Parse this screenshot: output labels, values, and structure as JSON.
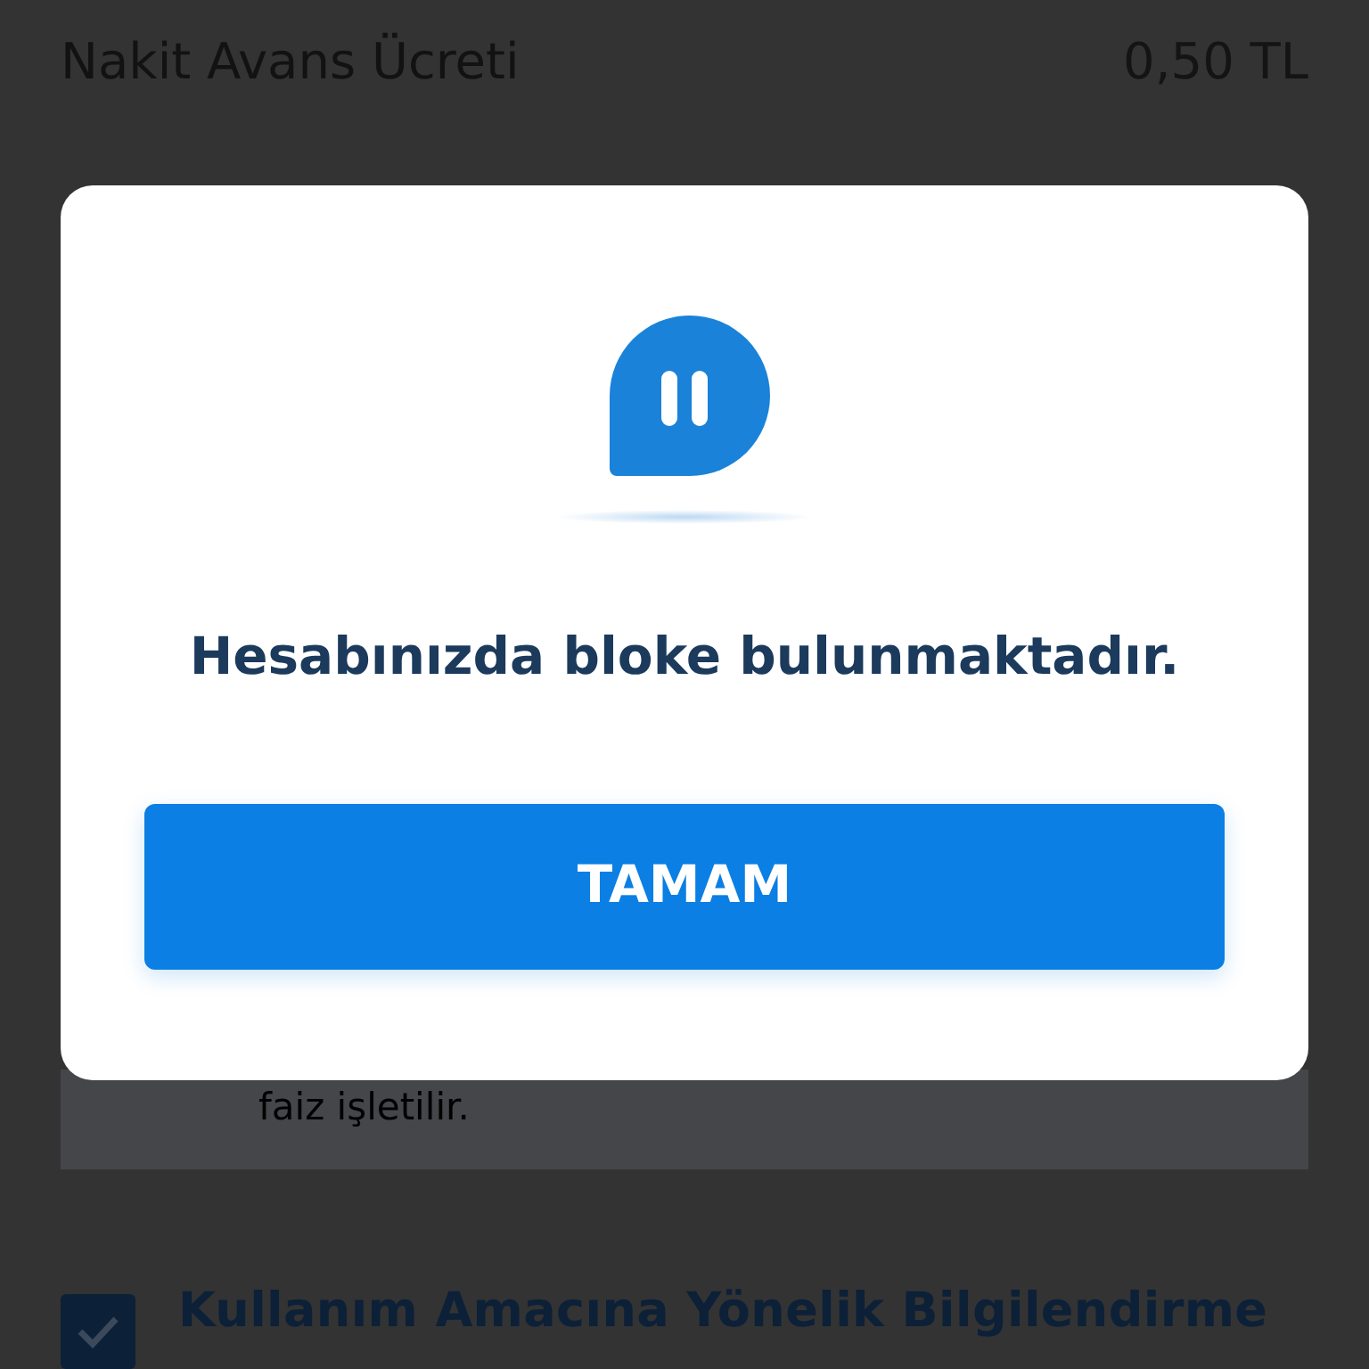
{
  "fee_row": {
    "label": "Nakit Avans Ücreti",
    "value": "0,50 TL"
  },
  "info_box": {
    "text": "faiz işletilir."
  },
  "consent": {
    "checked": true,
    "title": "Kullanım Amacına Yönelik Bilgilendirme"
  },
  "dialog": {
    "message": "Hesabınızda bloke bulunmaktadır.",
    "button": "TAMAM"
  }
}
